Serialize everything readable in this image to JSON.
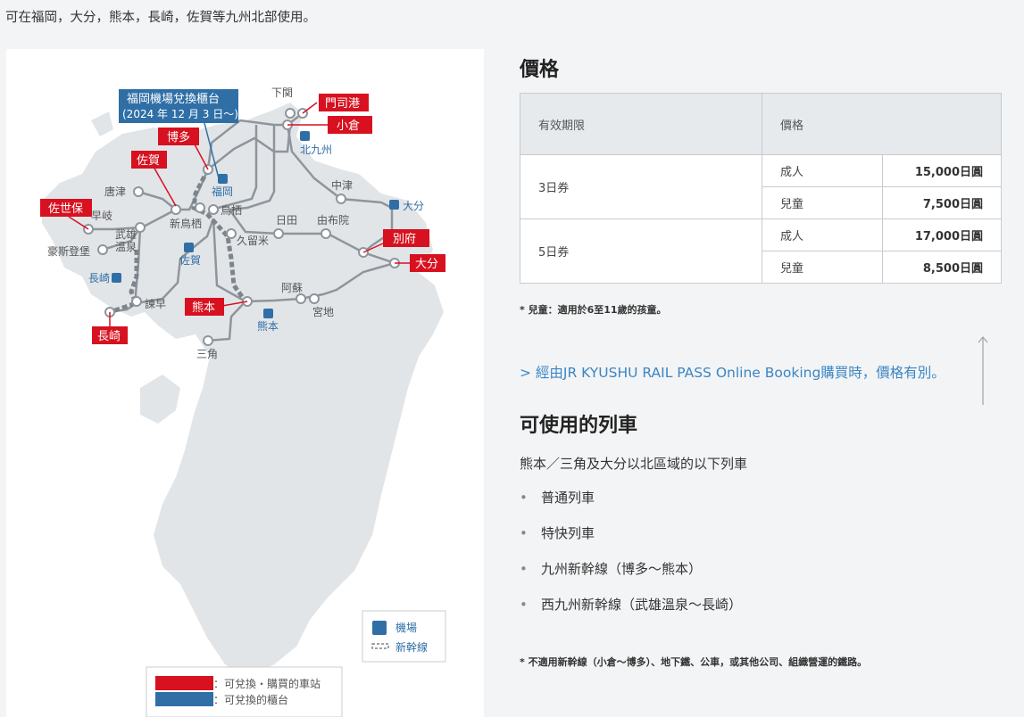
{
  "intro": "可在福岡，大分，熊本，長崎，佐賀等九州北部使用。",
  "map": {
    "airport_counter": [
      "福岡機場兌換櫃台",
      "(2024 年 12 月 3 日〜)"
    ],
    "red_stations": [
      "門司港",
      "小倉",
      "博多",
      "佐賀",
      "佐世保",
      "別府",
      "大分",
      "熊本",
      "長崎"
    ],
    "gray_stations": [
      "下関",
      "中津",
      "唐津",
      "早岐",
      "武雄",
      "溫泉",
      "豪斯登堡",
      "新鳥栖",
      "鳥栖",
      "日田",
      "由布院",
      "久留米",
      "阿蘇",
      "宮地",
      "諫早",
      "三角"
    ],
    "airports": [
      "北九州",
      "福岡",
      "大分",
      "佐賀",
      "長崎",
      "熊本"
    ],
    "legend": {
      "airport": "機場",
      "shinkansen": "新幹線"
    },
    "key": {
      "red": "：可兌換・購買的車站",
      "blue": "：可兌換的櫃台"
    },
    "colors": {
      "red": "#d7111f",
      "blue": "#2f6fa6",
      "land": "#e2e5e8",
      "line": "#8e959c",
      "shinkansen": "#7d858c"
    }
  },
  "price": {
    "title": "價格",
    "headers": {
      "period": "有效期限",
      "price": "價格"
    },
    "rows": [
      {
        "period": "3日券",
        "adult_label": "成人",
        "adult_price": "15,000日圓",
        "child_label": "兒童",
        "child_price": "7,500日圓"
      },
      {
        "period": "5日券",
        "adult_label": "成人",
        "adult_price": "17,000日圓",
        "child_label": "兒童",
        "child_price": "8,500日圓"
      }
    ],
    "note": "* 兒童：適用於6至11歲的孩童。"
  },
  "link": "> 經由JR KYUSHU RAIL PASS Online Booking購買時，價格有別。",
  "trains": {
    "title": "可使用的列車",
    "subtitle": "熊本／三角及大分以北區域的以下列車",
    "bullet": "•",
    "items": [
      "普通列車",
      "特快列車",
      "九州新幹線（博多〜熊本）",
      "西九州新幹線（武雄溫泉〜長崎）"
    ],
    "note": "* 不適用新幹線（小倉〜博多）、地下鐵、公車，或其他公司、組織營運的鐵路。"
  }
}
